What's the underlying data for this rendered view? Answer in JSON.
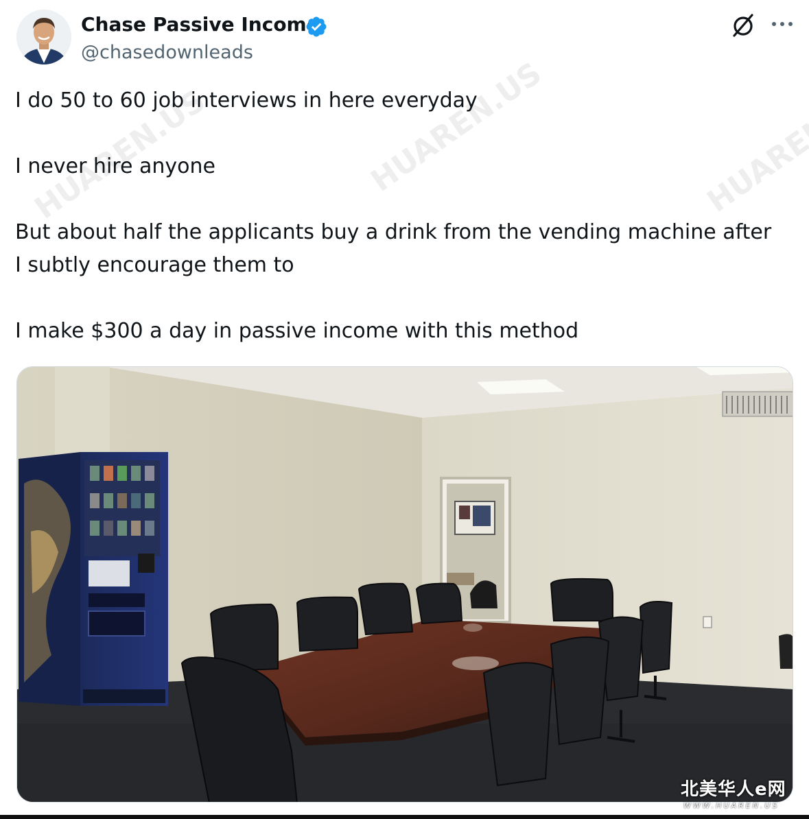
{
  "author": {
    "name": "Chase Passive Income",
    "handle": "@chasedownleads",
    "verified": true,
    "avatar_icon": "avatar-photo",
    "verified_color": "#1d9bf0"
  },
  "actions": {
    "grok_icon": "grok-icon",
    "more_icon": "more-options-icon"
  },
  "post": {
    "line1": "I do 50 to 60 job interviews in here everyday",
    "line2": "I never hire anyone",
    "line3a": "But about half the applicants buy a drink from the vending machine after",
    "line3b": "I subtly encourage them to",
    "line4": "I make $300 a day in passive income with this method"
  },
  "media": {
    "type": "photo",
    "scene": "conference-room-with-vending-machine"
  },
  "watermark": {
    "text": "HUAREN.US",
    "badge": "北美华人e网",
    "url": "WWW.HUAREN.US"
  },
  "colors": {
    "text": "#0f1419",
    "secondary": "#536471",
    "accent": "#1d9bf0"
  }
}
